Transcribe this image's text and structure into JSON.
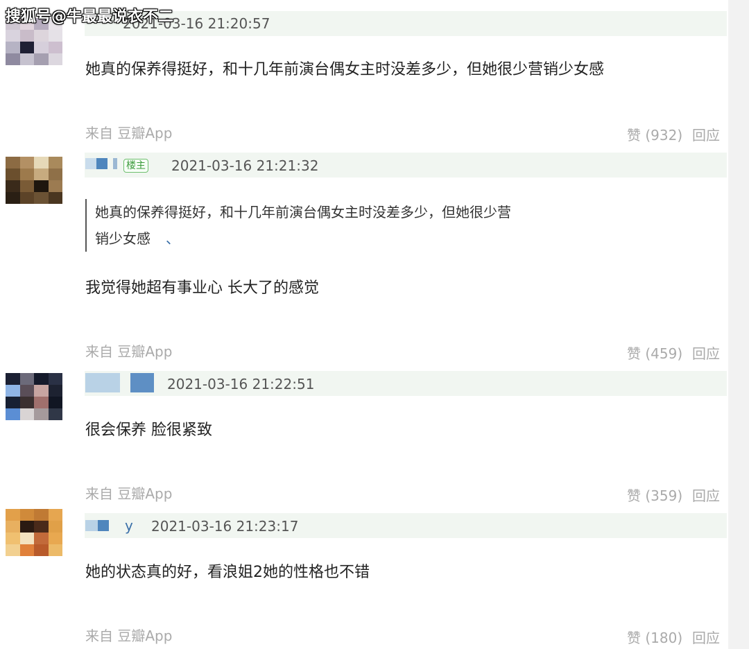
{
  "watermark": "搜狐号@牛最最说衣不二",
  "comments": [
    {
      "timestamp": "2021-03-16 21:20:57",
      "text": "她真的保养得挺好，和十几年前演台偶女主时没差多少，但她很少营销少女感",
      "source": "来自 豆瓣App",
      "likes": "赞 (932)",
      "reply": "回应"
    },
    {
      "timestamp": "2021-03-16 21:21:32",
      "badge": "楼主",
      "quote_line1": "她真的保养得挺好，和十几年前演台偶女主时没差多少，但她很少营",
      "quote_line2": "销少女感",
      "quote_mark": "、",
      "text": "我觉得她超有事业心 长大了的感觉",
      "source": "来自 豆瓣App",
      "likes": "赞 (459)",
      "reply": "回应"
    },
    {
      "timestamp": "2021-03-16 21:22:51",
      "text": "很会保养 脸很紧致",
      "source": "来自 豆瓣App",
      "likes": "赞 (359)",
      "reply": "回应"
    },
    {
      "username_tail": "y",
      "timestamp": "2021-03-16 21:23:17",
      "text": "她的状态真的好，看浪姐2她的性格也不错",
      "source": "来自 豆瓣App",
      "likes": "赞 (180)",
      "reply": "回应"
    }
  ],
  "colors": {
    "header_bar": "#f1f6f1",
    "username": "#3a6fa8",
    "muted": "#aaaaaa",
    "badge_green": "#3c9a3c"
  }
}
